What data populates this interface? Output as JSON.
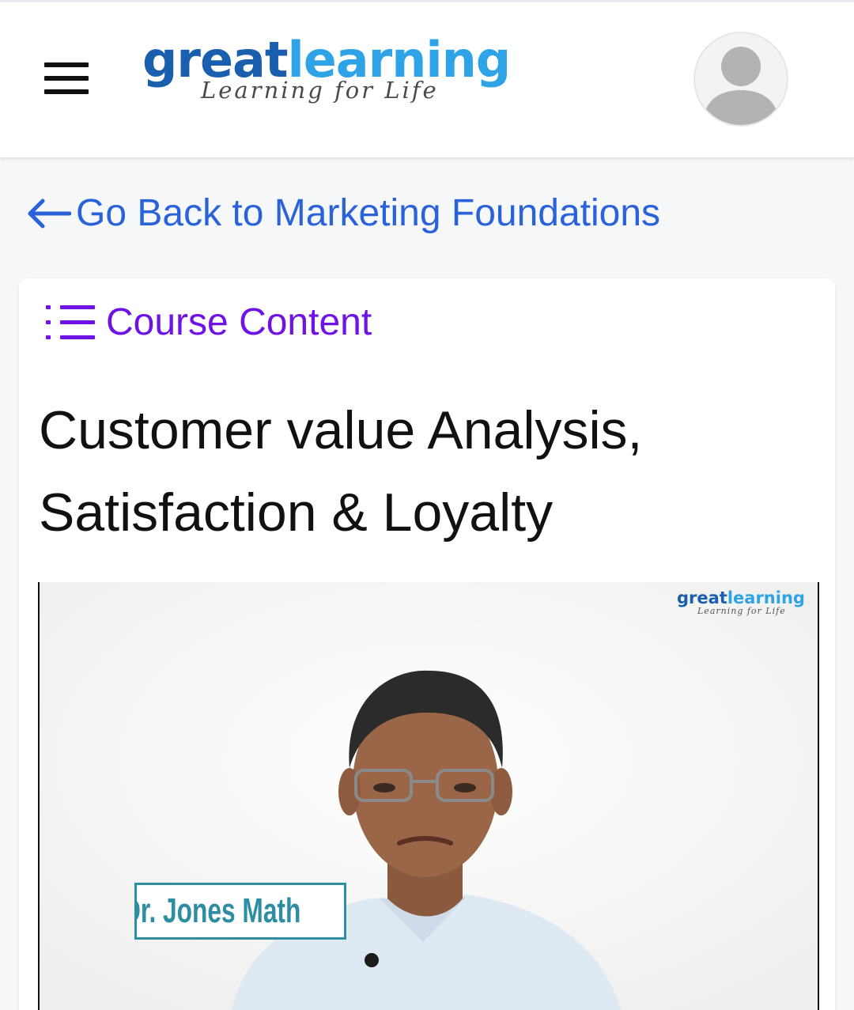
{
  "header": {
    "menu_icon": "hamburger-menu-icon",
    "logo": {
      "part1": "great",
      "part2": "learning",
      "tagline": "Learning for Life"
    },
    "avatar_icon": "user-avatar-icon"
  },
  "navigation": {
    "back_icon": "arrow-left-icon",
    "back_label": "Go Back to Marketing Foundations"
  },
  "content": {
    "course_content_icon": "list-icon",
    "course_content_label": "Course Content",
    "lesson_title": "Customer value Analysis, Satisfaction & Loyalty"
  },
  "video": {
    "watermark": {
      "part1": "great",
      "part2": "learning",
      "tagline": "Learning for Life"
    },
    "speaker_caption": "Dr. Jones Math"
  },
  "colors": {
    "link": "#2a62d9",
    "course_content": "#6e12e6",
    "brand_dark": "#1a5fad",
    "brand_light": "#2ea4e6",
    "caption": "#2c8da3"
  }
}
